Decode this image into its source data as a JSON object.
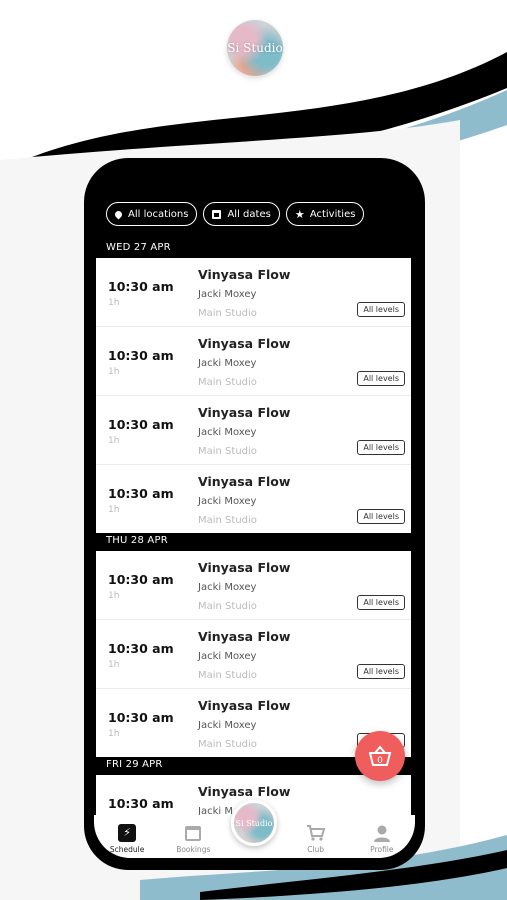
{
  "brand": {
    "logo_text": "Si Studio"
  },
  "filters": [
    {
      "label": "All locations",
      "icon": "location-pin-icon"
    },
    {
      "label": "All dates",
      "icon": "calendar-icon"
    },
    {
      "label": "Activities",
      "icon": "star-icon"
    }
  ],
  "days": [
    {
      "label": "WED 27 APR"
    },
    {
      "label": "THU 28 APR"
    },
    {
      "label": "FRI 29 APR"
    }
  ],
  "classes": {
    "time": "10:30 am",
    "duration": "1h",
    "title": "Vinyasa Flow",
    "teacher": "Jacki Moxey",
    "teacher_partial": "Jacki M",
    "room": "Main Studio",
    "level": "All levels"
  },
  "nav": [
    {
      "label": "Schedule",
      "icon": "lightning-icon"
    },
    {
      "label": "Bookings",
      "icon": "calendar-icon"
    },
    {
      "label": "Club",
      "icon": "cart-icon"
    },
    {
      "label": "Profile",
      "icon": "user-icon"
    }
  ],
  "basket": {
    "count": "0"
  },
  "colors": {
    "accent": "#ef5d5d",
    "wave_blue": "#8fbccd",
    "phone": "#000000"
  }
}
